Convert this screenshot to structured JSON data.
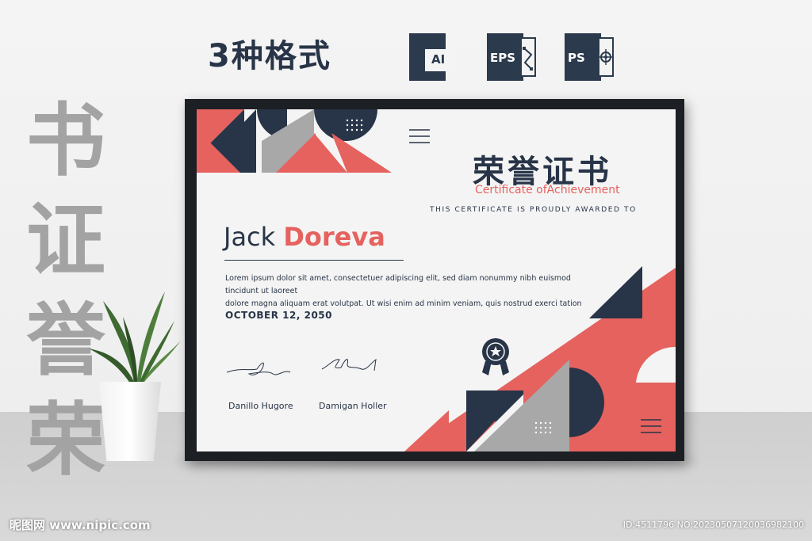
{
  "header": {
    "formats_title": "3种格式",
    "formats": [
      {
        "label": "AI",
        "icon": "ai-file-icon"
      },
      {
        "label": "EPS",
        "icon": "eps-file-icon"
      },
      {
        "label": "PS",
        "icon": "ps-file-icon"
      }
    ]
  },
  "side_text": [
    "书",
    "证",
    "誉",
    "荣"
  ],
  "certificate": {
    "cn_title": "荣誉证书",
    "en_title": "Certificate ofAchievement",
    "awarded_text": "THIS CERTIFICATE IS PROUDLY AWARDED TO",
    "first_name": "Jack",
    "last_name": "Doreva",
    "body_line1": "Lorem ipsum dolor sit amet, consectetuer adipiscing elit, sed diam nonummy nibh euismod tincidunt ut laoreet",
    "body_line2": "dolore magna aliquam erat volutpat. Ut wisi enim ad minim veniam, quis nostrud exerci tation",
    "date": "OCTOBER 12, 2050",
    "signer1": "Danillo Hugore",
    "signer2": "Damigan Holler"
  },
  "colors": {
    "navy": "#283447",
    "coral": "#e5625e",
    "gray": "#a8a8a8"
  },
  "watermark": {
    "left": "昵图网 www.nipic.com",
    "right": "ID:4511796 NO:20230507120036982100"
  }
}
